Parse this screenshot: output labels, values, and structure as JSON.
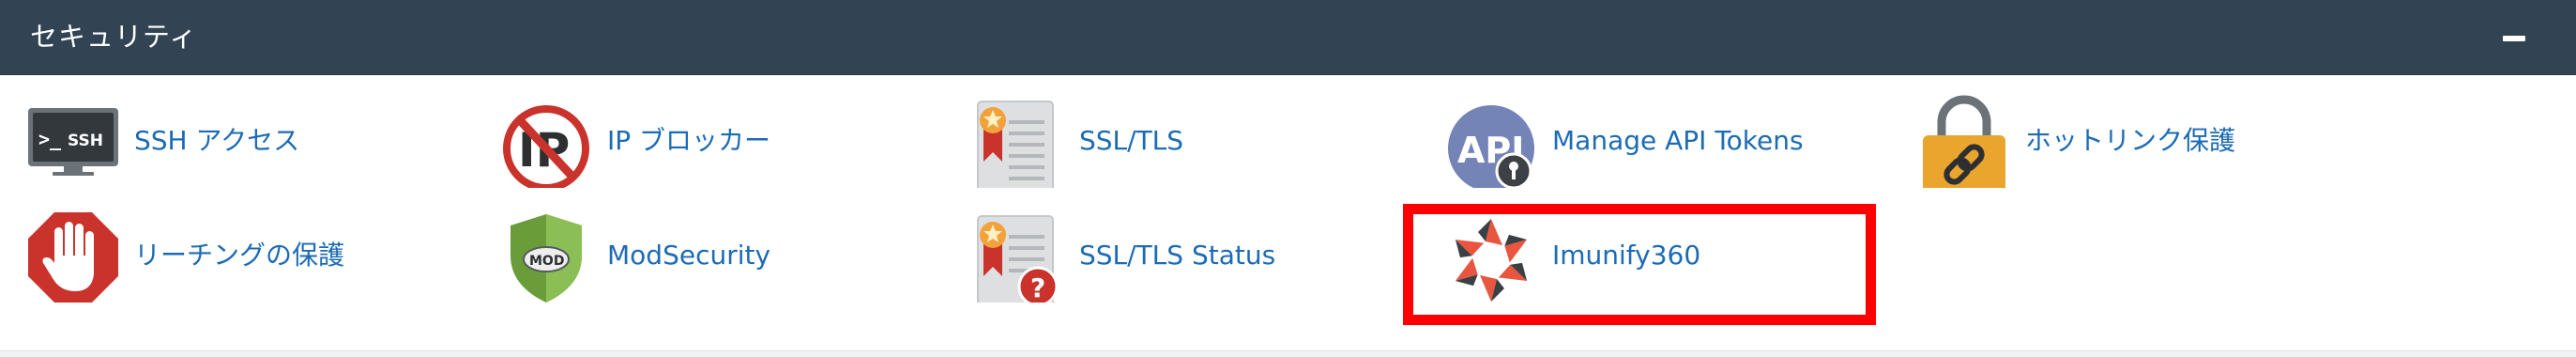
{
  "panel": {
    "title": "セキュリティ",
    "collapse_label": "−"
  },
  "items": [
    {
      "label": "SSH アクセス",
      "icon": "ssh-terminal-icon"
    },
    {
      "label": "IP ブロッカー",
      "icon": "ip-blocker-icon"
    },
    {
      "label": "SSL/TLS",
      "icon": "ssl-certificate-icon"
    },
    {
      "label": "Manage API Tokens",
      "icon": "api-tokens-icon"
    },
    {
      "label": "ホットリンク保護",
      "icon": "padlock-link-icon"
    },
    {
      "label": "リーチングの保護",
      "icon": "stop-hand-icon"
    },
    {
      "label": "ModSecurity",
      "icon": "mod-shield-icon"
    },
    {
      "label": "SSL/TLS Status",
      "icon": "ssl-status-icon"
    },
    {
      "label": "Imunify360",
      "icon": "imunify360-icon",
      "highlighted": true
    }
  ],
  "colors": {
    "header_bg": "#324454",
    "link": "#1c6bb5",
    "highlight": "#ff0000"
  }
}
